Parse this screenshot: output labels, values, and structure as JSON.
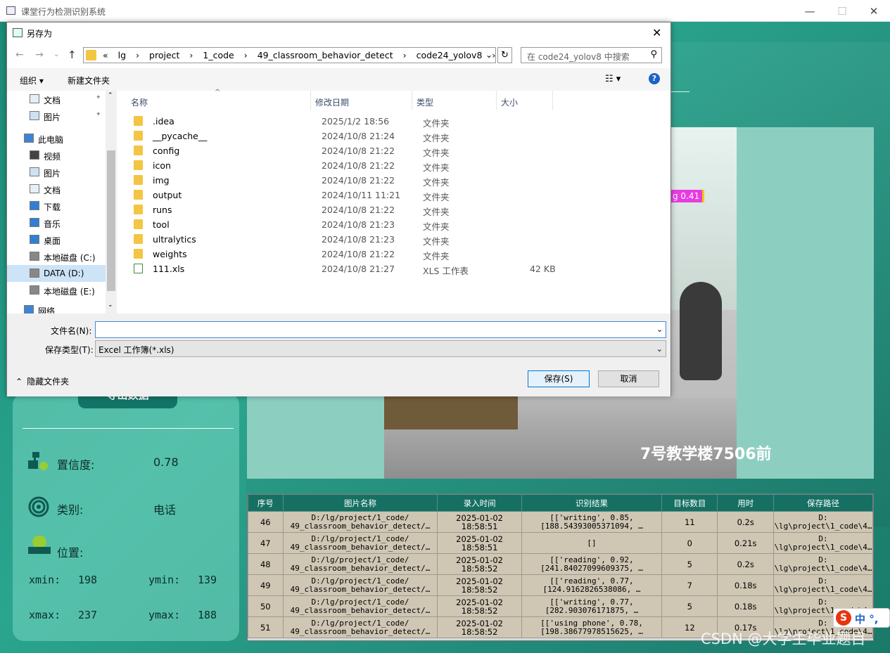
{
  "app": {
    "title": "课堂行为检测识别系统",
    "minimize": "—",
    "maximize": "☐",
    "close": "✕"
  },
  "left_panel": {
    "export_label": "导出数据",
    "confidence_label": "置信度:",
    "confidence_value": "0.78",
    "class_label": "类别:",
    "class_value": "电话",
    "position_label": "位置:",
    "xmin_label": "xmin:",
    "xmin_value": "198",
    "ymin_label": "ymin:",
    "ymin_value": "139",
    "xmax_label": "xmax:",
    "xmax_value": "237",
    "ymax_label": "ymax:",
    "ymax_value": "188"
  },
  "video": {
    "bbox_label": "g 0.41",
    "caption": "7号教学楼7506前"
  },
  "results_table": {
    "headers": [
      "序号",
      "图片名称",
      "录入时间",
      "识别结果",
      "目标数目",
      "用时",
      "保存路径"
    ],
    "rows": [
      {
        "id": "46",
        "name1": "D:/lg/project/1_code/",
        "name2": "49_classroom_behavior_detect/…",
        "date": "2025-01-02",
        "time": "18:58:51",
        "res1": "[['writing', 0.85,",
        "res2": "[188.54393005371094, …",
        "count": "11",
        "dur": "0.2s",
        "path1": "D:",
        "path2": "\\lg\\project\\1_code\\4…"
      },
      {
        "id": "47",
        "name1": "D:/lg/project/1_code/",
        "name2": "49_classroom_behavior_detect/…",
        "date": "2025-01-02",
        "time": "18:58:51",
        "res1": "[]",
        "res2": "",
        "count": "0",
        "dur": "0.21s",
        "path1": "D:",
        "path2": "\\lg\\project\\1_code\\4…"
      },
      {
        "id": "48",
        "name1": "D:/lg/project/1_code/",
        "name2": "49_classroom_behavior_detect/…",
        "date": "2025-01-02",
        "time": "18:58:52",
        "res1": "[['reading', 0.92,",
        "res2": "[241.84027099609375, …",
        "count": "5",
        "dur": "0.2s",
        "path1": "D:",
        "path2": "\\lg\\project\\1_code\\4…"
      },
      {
        "id": "49",
        "name1": "D:/lg/project/1_code/",
        "name2": "49_classroom_behavior_detect/…",
        "date": "2025-01-02",
        "time": "18:58:52",
        "res1": "[['reading', 0.77,",
        "res2": "[124.9162826538086, …",
        "count": "7",
        "dur": "0.18s",
        "path1": "D:",
        "path2": "\\lg\\project\\1_code\\4…"
      },
      {
        "id": "50",
        "name1": "D:/lg/project/1_code/",
        "name2": "49_classroom_behavior_detect/…",
        "date": "2025-01-02",
        "time": "18:58:52",
        "res1": "[['writing', 0.77,",
        "res2": "[282.903076171875, …",
        "count": "5",
        "dur": "0.18s",
        "path1": "D:",
        "path2": "\\lg\\project\\1_code\\4…"
      },
      {
        "id": "51",
        "name1": "D:/lg/project/1_code/",
        "name2": "49_classroom_behavior_detect/…",
        "date": "2025-01-02",
        "time": "18:58:52",
        "res1": "[['using phone', 0.78,",
        "res2": "[198.38677978515625, …",
        "count": "12",
        "dur": "0.17s",
        "path1": "D:",
        "path2": "\\lg\\project\\1_code\\4…"
      }
    ]
  },
  "ime": {
    "label": "中 °,"
  },
  "watermark": "CSDN @大学生毕业题目",
  "dialog": {
    "title": "另存为",
    "close": "✕",
    "back": "←",
    "forward": "→",
    "up": "↑",
    "breadcrumbs": [
      "«",
      "lg",
      "›",
      "project",
      "›",
      "1_code",
      "›",
      "49_classroom_behavior_detect",
      "›",
      "code24_yolov8",
      "›"
    ],
    "refresh": "↻",
    "search_placeholder": "在 code24_yolov8 中搜索",
    "organize": "组织 ▾",
    "new_folder": "新建文件夹",
    "view": "☷ ▾",
    "help": "?",
    "nav_items": [
      {
        "label": "文档",
        "icon": "document-icon",
        "pin": "✦"
      },
      {
        "label": "图片",
        "icon": "picture-icon",
        "pin": "✦"
      },
      {
        "label": "此电脑",
        "icon": "computer-icon"
      },
      {
        "label": "视频",
        "icon": "video-icon"
      },
      {
        "label": "图片",
        "icon": "picture-icon"
      },
      {
        "label": "文档",
        "icon": "document-icon"
      },
      {
        "label": "下载",
        "icon": "download-icon"
      },
      {
        "label": "音乐",
        "icon": "music-icon"
      },
      {
        "label": "桌面",
        "icon": "desktop-icon"
      },
      {
        "label": "本地磁盘 (C:)",
        "icon": "drive-icon"
      },
      {
        "label": "DATA (D:)",
        "icon": "drive-icon"
      },
      {
        "label": "本地磁盘 (E:)",
        "icon": "drive-icon"
      },
      {
        "label": "网络",
        "icon": "network-icon"
      }
    ],
    "columns": {
      "name": "名称",
      "date": "修改日期",
      "type": "类型",
      "size": "大小"
    },
    "files": [
      {
        "name": ".idea",
        "date": "2025/1/2 18:56",
        "type": "文件夹",
        "size": ""
      },
      {
        "name": "__pycache__",
        "date": "2024/10/8 21:24",
        "type": "文件夹",
        "size": ""
      },
      {
        "name": "config",
        "date": "2024/10/8 21:22",
        "type": "文件夹",
        "size": ""
      },
      {
        "name": "icon",
        "date": "2024/10/8 21:22",
        "type": "文件夹",
        "size": ""
      },
      {
        "name": "img",
        "date": "2024/10/8 21:22",
        "type": "文件夹",
        "size": ""
      },
      {
        "name": "output",
        "date": "2024/10/11 11:21",
        "type": "文件夹",
        "size": ""
      },
      {
        "name": "runs",
        "date": "2024/10/8 21:22",
        "type": "文件夹",
        "size": ""
      },
      {
        "name": "tool",
        "date": "2024/10/8 21:23",
        "type": "文件夹",
        "size": ""
      },
      {
        "name": "ultralytics",
        "date": "2024/10/8 21:23",
        "type": "文件夹",
        "size": ""
      },
      {
        "name": "weights",
        "date": "2024/10/8 21:22",
        "type": "文件夹",
        "size": ""
      },
      {
        "name": "111.xls",
        "date": "2024/10/8 21:27",
        "type": "XLS 工作表",
        "size": "42 KB"
      }
    ],
    "filename_label": "文件名(N):",
    "filename_value": "",
    "filetype_label": "保存类型(T):",
    "filetype_value": "Excel 工作簿(*.xls)",
    "hide_folders": "隐藏文件夹",
    "save": "保存(S)",
    "cancel": "取消"
  }
}
